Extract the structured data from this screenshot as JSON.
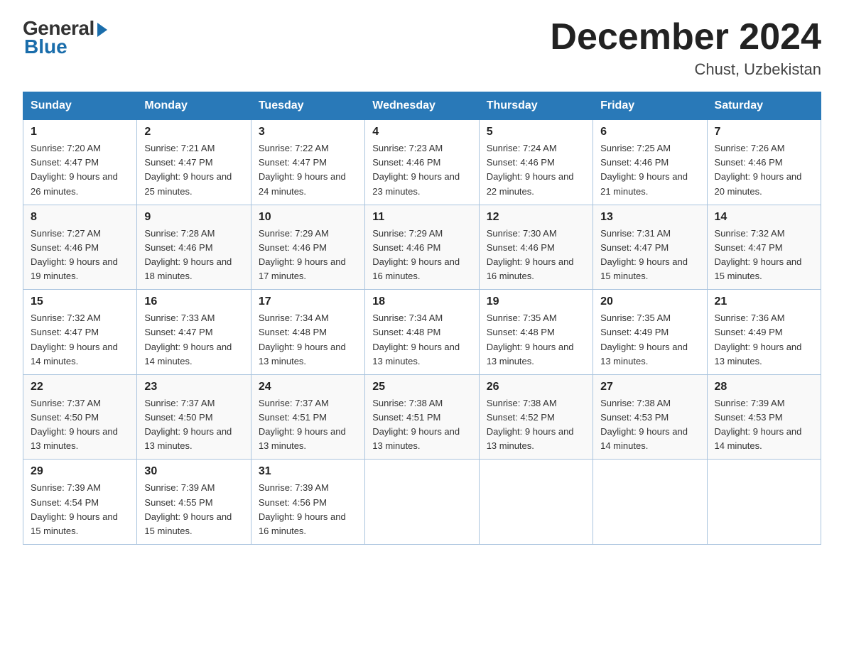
{
  "header": {
    "logo_general": "General",
    "logo_blue": "Blue",
    "month_title": "December 2024",
    "location": "Chust, Uzbekistan"
  },
  "days_of_week": [
    "Sunday",
    "Monday",
    "Tuesday",
    "Wednesday",
    "Thursday",
    "Friday",
    "Saturday"
  ],
  "weeks": [
    [
      {
        "num": "1",
        "sunrise": "7:20 AM",
        "sunset": "4:47 PM",
        "daylight": "9 hours and 26 minutes."
      },
      {
        "num": "2",
        "sunrise": "7:21 AM",
        "sunset": "4:47 PM",
        "daylight": "9 hours and 25 minutes."
      },
      {
        "num": "3",
        "sunrise": "7:22 AM",
        "sunset": "4:47 PM",
        "daylight": "9 hours and 24 minutes."
      },
      {
        "num": "4",
        "sunrise": "7:23 AM",
        "sunset": "4:46 PM",
        "daylight": "9 hours and 23 minutes."
      },
      {
        "num": "5",
        "sunrise": "7:24 AM",
        "sunset": "4:46 PM",
        "daylight": "9 hours and 22 minutes."
      },
      {
        "num": "6",
        "sunrise": "7:25 AM",
        "sunset": "4:46 PM",
        "daylight": "9 hours and 21 minutes."
      },
      {
        "num": "7",
        "sunrise": "7:26 AM",
        "sunset": "4:46 PM",
        "daylight": "9 hours and 20 minutes."
      }
    ],
    [
      {
        "num": "8",
        "sunrise": "7:27 AM",
        "sunset": "4:46 PM",
        "daylight": "9 hours and 19 minutes."
      },
      {
        "num": "9",
        "sunrise": "7:28 AM",
        "sunset": "4:46 PM",
        "daylight": "9 hours and 18 minutes."
      },
      {
        "num": "10",
        "sunrise": "7:29 AM",
        "sunset": "4:46 PM",
        "daylight": "9 hours and 17 minutes."
      },
      {
        "num": "11",
        "sunrise": "7:29 AM",
        "sunset": "4:46 PM",
        "daylight": "9 hours and 16 minutes."
      },
      {
        "num": "12",
        "sunrise": "7:30 AM",
        "sunset": "4:46 PM",
        "daylight": "9 hours and 16 minutes."
      },
      {
        "num": "13",
        "sunrise": "7:31 AM",
        "sunset": "4:47 PM",
        "daylight": "9 hours and 15 minutes."
      },
      {
        "num": "14",
        "sunrise": "7:32 AM",
        "sunset": "4:47 PM",
        "daylight": "9 hours and 15 minutes."
      }
    ],
    [
      {
        "num": "15",
        "sunrise": "7:32 AM",
        "sunset": "4:47 PM",
        "daylight": "9 hours and 14 minutes."
      },
      {
        "num": "16",
        "sunrise": "7:33 AM",
        "sunset": "4:47 PM",
        "daylight": "9 hours and 14 minutes."
      },
      {
        "num": "17",
        "sunrise": "7:34 AM",
        "sunset": "4:48 PM",
        "daylight": "9 hours and 13 minutes."
      },
      {
        "num": "18",
        "sunrise": "7:34 AM",
        "sunset": "4:48 PM",
        "daylight": "9 hours and 13 minutes."
      },
      {
        "num": "19",
        "sunrise": "7:35 AM",
        "sunset": "4:48 PM",
        "daylight": "9 hours and 13 minutes."
      },
      {
        "num": "20",
        "sunrise": "7:35 AM",
        "sunset": "4:49 PM",
        "daylight": "9 hours and 13 minutes."
      },
      {
        "num": "21",
        "sunrise": "7:36 AM",
        "sunset": "4:49 PM",
        "daylight": "9 hours and 13 minutes."
      }
    ],
    [
      {
        "num": "22",
        "sunrise": "7:37 AM",
        "sunset": "4:50 PM",
        "daylight": "9 hours and 13 minutes."
      },
      {
        "num": "23",
        "sunrise": "7:37 AM",
        "sunset": "4:50 PM",
        "daylight": "9 hours and 13 minutes."
      },
      {
        "num": "24",
        "sunrise": "7:37 AM",
        "sunset": "4:51 PM",
        "daylight": "9 hours and 13 minutes."
      },
      {
        "num": "25",
        "sunrise": "7:38 AM",
        "sunset": "4:51 PM",
        "daylight": "9 hours and 13 minutes."
      },
      {
        "num": "26",
        "sunrise": "7:38 AM",
        "sunset": "4:52 PM",
        "daylight": "9 hours and 13 minutes."
      },
      {
        "num": "27",
        "sunrise": "7:38 AM",
        "sunset": "4:53 PM",
        "daylight": "9 hours and 14 minutes."
      },
      {
        "num": "28",
        "sunrise": "7:39 AM",
        "sunset": "4:53 PM",
        "daylight": "9 hours and 14 minutes."
      }
    ],
    [
      {
        "num": "29",
        "sunrise": "7:39 AM",
        "sunset": "4:54 PM",
        "daylight": "9 hours and 15 minutes."
      },
      {
        "num": "30",
        "sunrise": "7:39 AM",
        "sunset": "4:55 PM",
        "daylight": "9 hours and 15 minutes."
      },
      {
        "num": "31",
        "sunrise": "7:39 AM",
        "sunset": "4:56 PM",
        "daylight": "9 hours and 16 minutes."
      },
      null,
      null,
      null,
      null
    ]
  ]
}
